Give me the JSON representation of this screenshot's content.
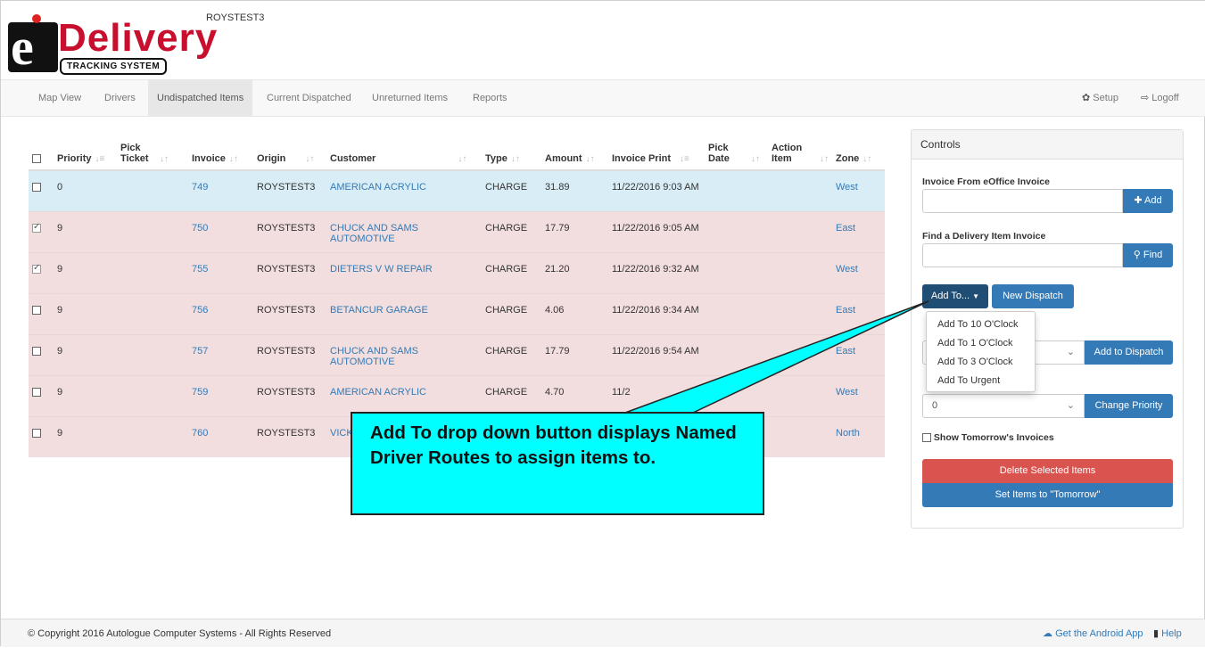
{
  "header": {
    "brand": "Delivery",
    "tagline": "TRACKING SYSTEM",
    "account": "ROYSTEST3"
  },
  "nav": {
    "items": [
      "Map View",
      "Drivers",
      "Undispatched Items",
      "Current Dispatched",
      "Unreturned Items",
      "Reports"
    ],
    "active": "Undispatched Items",
    "setup": "Setup",
    "logoff": "Logoff"
  },
  "table": {
    "headers": [
      "Priority",
      "Pick Ticket",
      "Invoice",
      "Origin",
      "Customer",
      "Type",
      "Amount",
      "Invoice Print",
      "Pick Date",
      "Action Item",
      "Zone"
    ],
    "rows": [
      {
        "checked": false,
        "priority": "0",
        "invoice": "749",
        "origin": "ROYSTEST3",
        "customer": "AMERICAN ACRYLIC",
        "type": "CHARGE",
        "amount": "31.89",
        "print": "11/22/2016 9:03 AM",
        "zone": "West",
        "style": "blue"
      },
      {
        "checked": true,
        "priority": "9",
        "invoice": "750",
        "origin": "ROYSTEST3",
        "customer": "CHUCK AND SAMS AUTOMOTIVE",
        "type": "CHARGE",
        "amount": "17.79",
        "print": "11/22/2016 9:05 AM",
        "zone": "East",
        "style": "red"
      },
      {
        "checked": true,
        "priority": "9",
        "invoice": "755",
        "origin": "ROYSTEST3",
        "customer": "DIETERS V W REPAIR",
        "type": "CHARGE",
        "amount": "21.20",
        "print": "11/22/2016 9:32 AM",
        "zone": "West",
        "style": "red"
      },
      {
        "checked": false,
        "priority": "9",
        "invoice": "756",
        "origin": "ROYSTEST3",
        "customer": "BETANCUR GARAGE",
        "type": "CHARGE",
        "amount": "4.06",
        "print": "11/22/2016 9:34 AM",
        "zone": "East",
        "style": "red"
      },
      {
        "checked": false,
        "priority": "9",
        "invoice": "757",
        "origin": "ROYSTEST3",
        "customer": "CHUCK AND SAMS AUTOMOTIVE",
        "type": "CHARGE",
        "amount": "17.79",
        "print": "11/22/2016 9:54 AM",
        "zone": "East",
        "style": "red"
      },
      {
        "checked": false,
        "priority": "9",
        "invoice": "759",
        "origin": "ROYSTEST3",
        "customer": "AMERICAN ACRYLIC",
        "type": "CHARGE",
        "amount": "4.70",
        "print": "11/2",
        "zone": "West",
        "style": "red"
      },
      {
        "checked": false,
        "priority": "9",
        "invoice": "760",
        "origin": "ROYSTEST3",
        "customer": "VICK",
        "type": "",
        "amount": "",
        "print": "",
        "zone": "North",
        "style": "red"
      }
    ]
  },
  "controls": {
    "title": "Controls",
    "invoice_from_label": "Invoice From eOffice Invoice",
    "add_button": "Add",
    "find_label": "Find a Delivery Item Invoice",
    "find_button": "Find",
    "add_to_button": "Add To...",
    "new_dispatch_button": "New Dispatch",
    "add_to_dispatch_button": "Add to Dispatch",
    "priority_value": "0",
    "change_priority_button": "Change Priority",
    "show_tomorrow_label": "Show Tomorrow's Invoices",
    "delete_button": "Delete Selected Items",
    "set_tomorrow_button": "Set Items to \"Tomorrow\""
  },
  "dropdown": {
    "items": [
      "Add To 10 O'Clock",
      "Add To 1 O'Clock",
      "Add To 3 O'Clock",
      "Add To Urgent"
    ]
  },
  "callout": {
    "text": "Add To drop down button displays Named Driver Routes to assign items to."
  },
  "footer": {
    "copyright": "© Copyright 2016 Autologue Computer Systems - All Rights Reserved",
    "android": "Get the Android App",
    "help": "Help"
  },
  "colors": {
    "row_selected": "#d9edf7",
    "row_danger": "#f2dede",
    "link": "#337ab7",
    "primary": "#337ab7",
    "danger": "#d9534f",
    "callout": "#00ffff",
    "brand_red": "#c8102e"
  }
}
